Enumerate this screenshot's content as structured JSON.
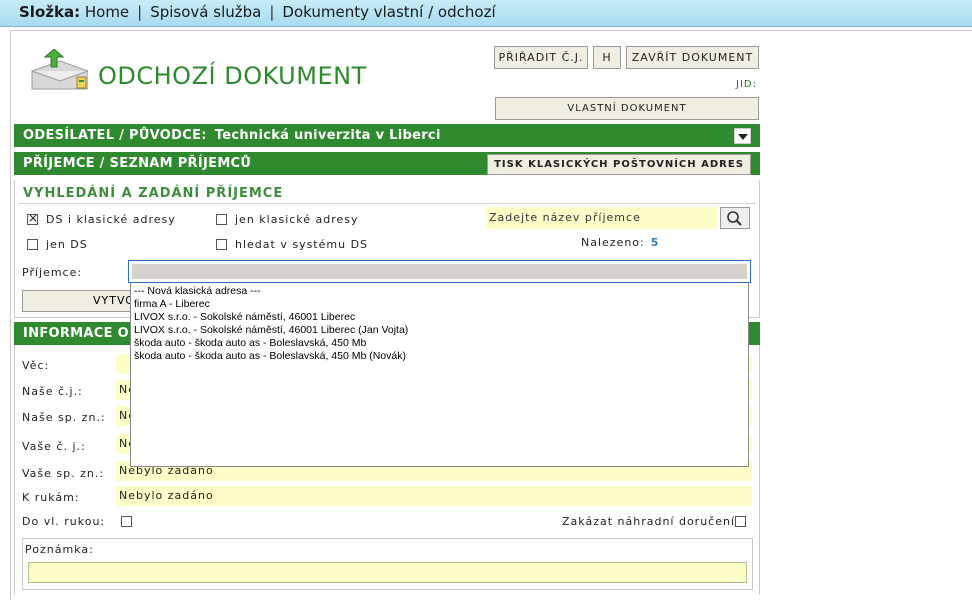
{
  "breadcrumb": {
    "prefix": "Složka:",
    "items": [
      "Home",
      "Spisová služba",
      "Dokumenty vlastní / odchozí"
    ]
  },
  "page": {
    "title": "ODCHOZÍ DOKUMENT"
  },
  "toolbar": {
    "assign_label": "PŘIŘADIT Č.J.",
    "h_label": "H",
    "close_label": "ZAVŘÍT DOKUMENT",
    "jid_label": "JID:",
    "own_doc_label": "VLASTNÍ DOKUMENT"
  },
  "sender": {
    "label": "ODESÍLATEL / PŮVODCE:",
    "value": "Technická univerzita v Liberci"
  },
  "recipients": {
    "header": "PŘÍJEMCE / SEZNAM PŘÍJEMCŮ",
    "print_label": "TISK KLASICKÝCH POŠTOVNÍCH ADRES",
    "search_title": "VYHLEDÁNÍ A ZADÁNÍ PŘÍJEMCE",
    "options": [
      {
        "label": "DS i klasické adresy",
        "checked": true
      },
      {
        "label": "jen klasické adresy",
        "checked": false
      },
      {
        "label": "jen DS",
        "checked": false
      },
      {
        "label": "hledat v systému DS",
        "checked": false
      }
    ],
    "search_value": "Zadejte název příjemce",
    "found_label": "Nalezeno:",
    "found_count": "5",
    "recipient_label": "Příjemce:",
    "create_button": "VYTVO",
    "dropdown": [
      "--- Nová klasická adresa ---",
      "firma A - Liberec",
      "LIVOX s.r.o. - Sokolské náměstí, 46001 Liberec",
      "LIVOX s.r.o. - Sokolské náměstí, 46001 Liberec (Jan Vojta)",
      "škoda auto - škoda auto as - Boleslavská, 450 Mb",
      "škoda auto - škoda auto as - Boleslavská, 450 Mb (Novák)"
    ]
  },
  "info": {
    "header": "INFORMACE O D",
    "fields": [
      {
        "label": "Věc:",
        "value": ""
      },
      {
        "label": "Naše č.j.:",
        "value": "Ne"
      },
      {
        "label": "Naše sp. zn.:",
        "value": "Ne"
      },
      {
        "label": "Vaše č. j.:",
        "value": "Ne"
      },
      {
        "label": "Vaše sp. zn.:",
        "value": "Nebylo zadáno"
      },
      {
        "label": "K rukám:",
        "value": "Nebylo zadáno"
      }
    ],
    "personal_label": "Do vl. rukou:",
    "forbid_label": "Zakázat náhradní doručení:",
    "note_label": "Poznámka:"
  },
  "colors": {
    "accent_green": "#2f8a2f",
    "field_yellow": "#fdfdc8",
    "topbar": "#b8e4f4"
  }
}
